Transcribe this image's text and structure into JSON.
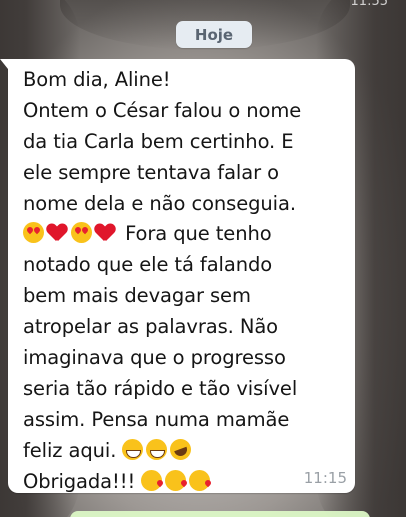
{
  "status_bar": {
    "time": "11:55"
  },
  "chat": {
    "date_chip": "Hoje",
    "message": {
      "lines": [
        {
          "text": "Bom dia, Aline!"
        },
        {
          "text": "Ontem o César falou o nome"
        },
        {
          "text": "da tia Carla bem certinho. E"
        },
        {
          "text": "ele sempre tentava falar o"
        },
        {
          "text": "nome dela e não conseguia."
        },
        {
          "text": "Fora que tenho"
        },
        {
          "text": "notado que ele tá falando"
        },
        {
          "text": "bem mais devagar sem"
        },
        {
          "text": "atropelar as palavras. Não"
        },
        {
          "text": "imaginava que o progresso"
        },
        {
          "text": "seria tão rápido e tão visível"
        },
        {
          "text": "assim. Pensa numa mamãe"
        },
        {
          "text": "feliz aqui."
        },
        {
          "text": "Obrigada!!!"
        }
      ],
      "emojis": {
        "line6": [
          "heart-eyes-emoji",
          "red-heart-emoji",
          "heart-eyes-emoji",
          "red-heart-emoji"
        ],
        "line13": [
          "grinning-emoji",
          "grinning-emoji",
          "rofl-emoji"
        ],
        "line14": [
          "kissing-heart-emoji",
          "kissing-heart-emoji",
          "kissing-heart-emoji"
        ]
      },
      "time": "11:15"
    }
  },
  "colors": {
    "bubble_incoming": "#ffffff",
    "bubble_outgoing": "#dcf8c6",
    "date_chip_bg": "#e6ecf2",
    "timestamp": "#9aa0a6"
  }
}
